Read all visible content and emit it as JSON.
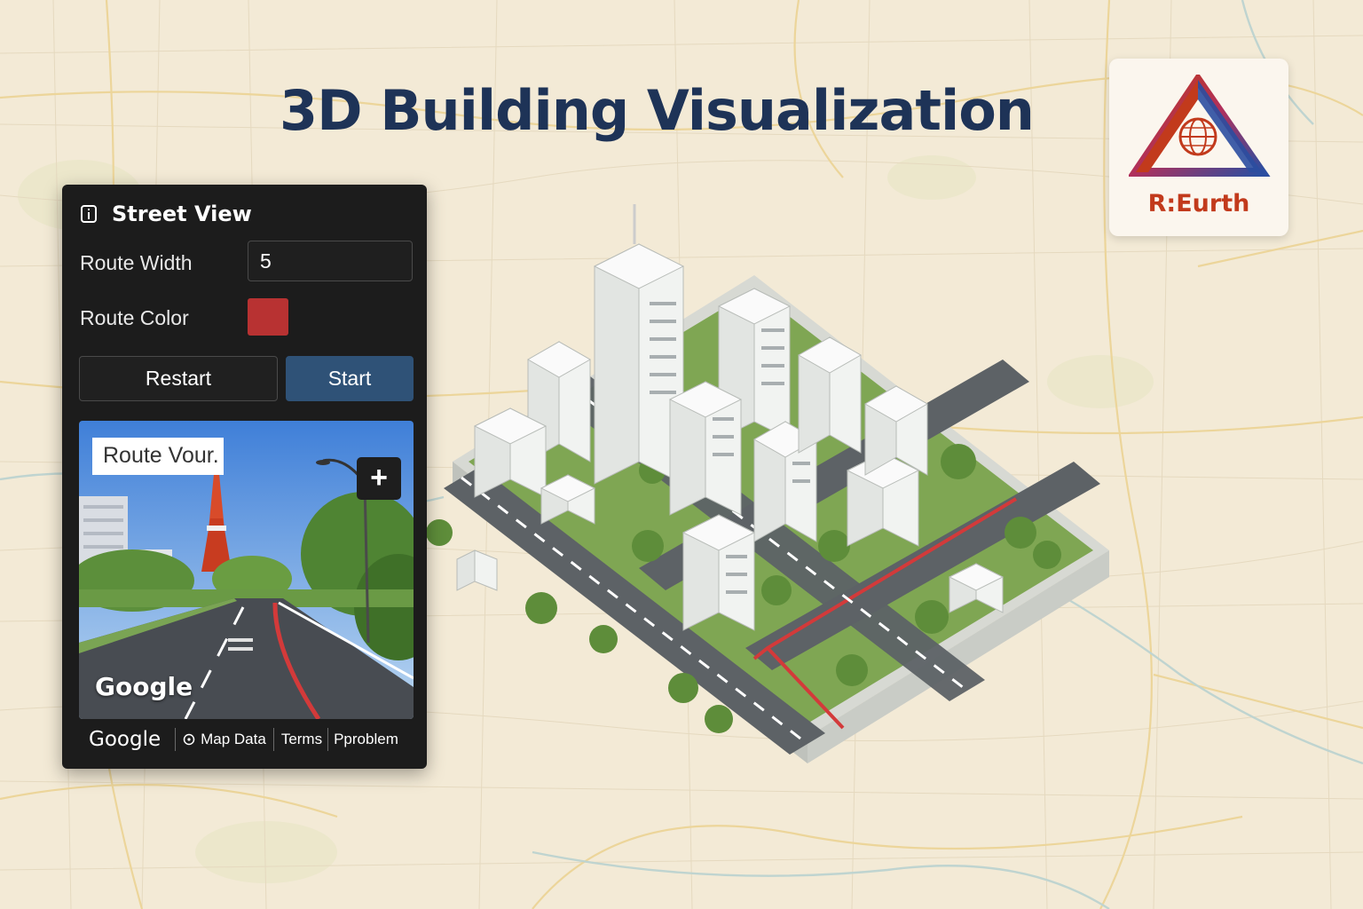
{
  "header": {
    "title": "3D Building Visualization"
  },
  "logo": {
    "text": "R:Eurth"
  },
  "panel": {
    "title": "Street View",
    "route_width": {
      "label": "Route Width",
      "value": "5"
    },
    "route_color": {
      "label": "Route Color",
      "value": "#b83232"
    },
    "buttons": {
      "restart": "Restart",
      "start": "Start"
    },
    "street_view": {
      "label": "Route Vour.",
      "zoom": "+",
      "watermark": "Google"
    },
    "footer": {
      "brand": "Google",
      "map_data": "Map Data",
      "terms": "Terms",
      "problem": "Pproblem"
    }
  },
  "colors": {
    "title": "#1e3357",
    "logo_red": "#c23a1c",
    "logo_blue": "#2b4ea0",
    "start_button": "#2f5277",
    "route": "#d33a3a"
  }
}
